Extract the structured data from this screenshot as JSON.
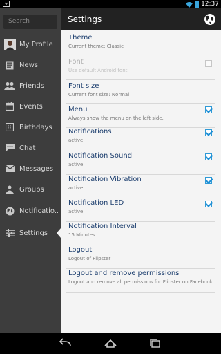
{
  "status_bar": {
    "time": "12:37"
  },
  "sidebar": {
    "search_placeholder": "Search",
    "items": [
      {
        "label": "My Profile",
        "icon": "avatar"
      },
      {
        "label": "News",
        "icon": "news-icon"
      },
      {
        "label": "Friends",
        "icon": "friends-icon"
      },
      {
        "label": "Events",
        "icon": "calendar-icon"
      },
      {
        "label": "Birthdays",
        "icon": "birthday-icon"
      },
      {
        "label": "Chat",
        "icon": "chat-icon"
      },
      {
        "label": "Messages",
        "icon": "envelope-icon"
      },
      {
        "label": "Groups",
        "icon": "groups-icon"
      },
      {
        "label": "Notificatio...",
        "icon": "globe-icon"
      },
      {
        "label": "Settings",
        "icon": "sliders-icon"
      }
    ]
  },
  "header": {
    "title": "Settings",
    "action_icon": "globe-icon"
  },
  "settings": [
    {
      "title": "Theme",
      "subtitle": "Current theme: Classic",
      "checkbox": null,
      "enabled": true
    },
    {
      "title": "Font",
      "subtitle": "Use default Android font.",
      "checkbox": false,
      "enabled": false
    },
    {
      "title": "Font size",
      "subtitle": "Current font size: Normal",
      "checkbox": null,
      "enabled": true
    },
    {
      "title": "Menu",
      "subtitle": "Always show the menu on the left side.",
      "checkbox": true,
      "enabled": true
    },
    {
      "title": "Notifications",
      "subtitle": "active",
      "checkbox": true,
      "enabled": true
    },
    {
      "title": "Notification Sound",
      "subtitle": "active",
      "checkbox": true,
      "enabled": true
    },
    {
      "title": "Notification Vibration",
      "subtitle": "active",
      "checkbox": true,
      "enabled": true
    },
    {
      "title": "Notification LED",
      "subtitle": "active",
      "checkbox": true,
      "enabled": true
    },
    {
      "title": "Notification Interval",
      "subtitle": "15 Minutes",
      "checkbox": null,
      "enabled": true
    },
    {
      "title": "Logout",
      "subtitle": "Logout of Flipster",
      "checkbox": null,
      "enabled": true
    },
    {
      "title": "Logout and remove permissions",
      "subtitle": "Logout and remove all permissions for Flipster on Facebook",
      "checkbox": null,
      "enabled": true
    }
  ],
  "colors": {
    "title_blue": "#1c3e6e",
    "check_blue": "#1e8fd6",
    "sidebar_bg": "#3d3d3d",
    "actionbar_bg": "#222222"
  }
}
